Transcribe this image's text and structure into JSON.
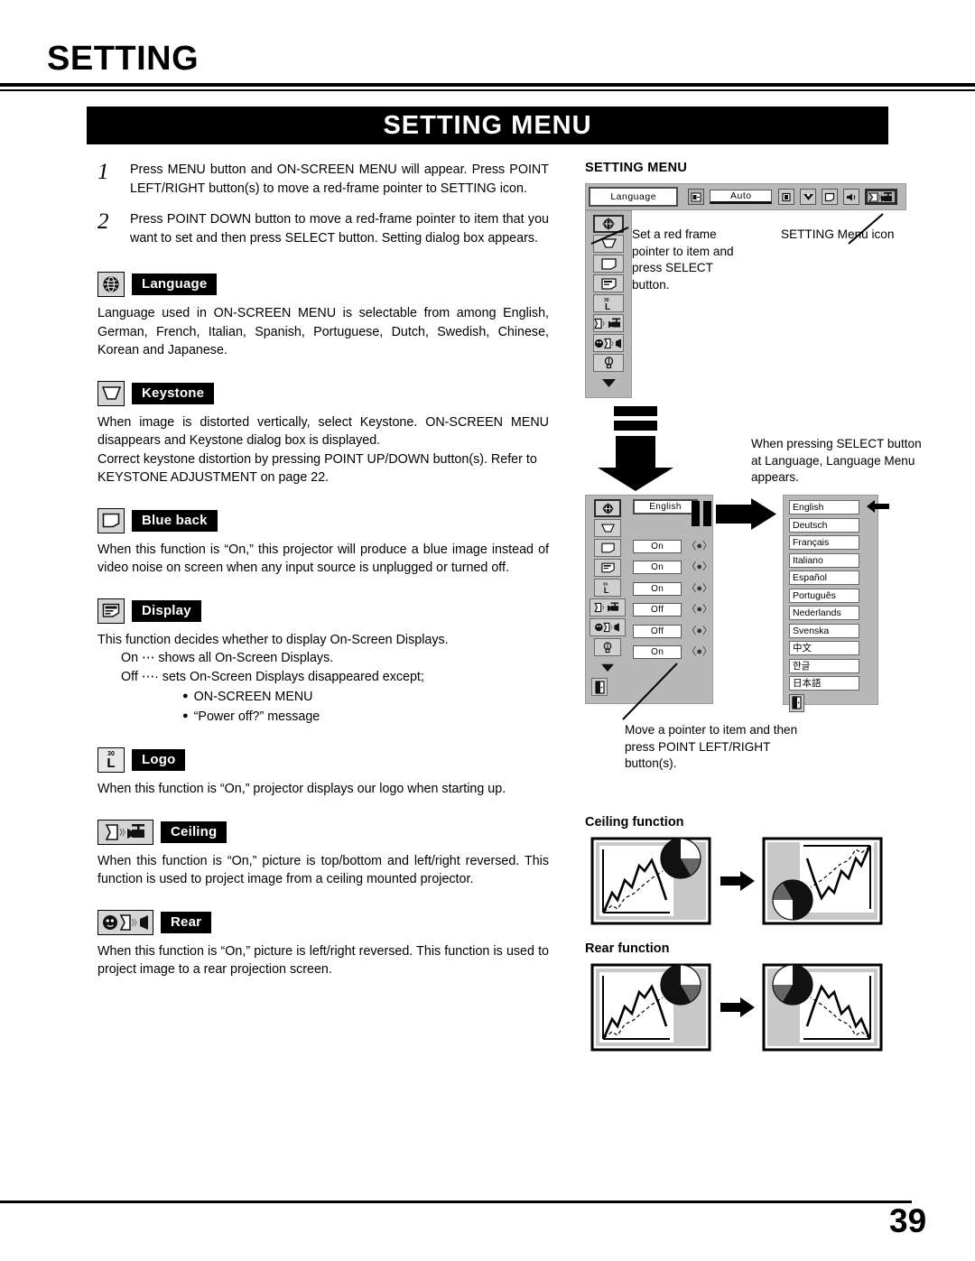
{
  "header": {
    "title": "SETTING",
    "banner": "SETTING MENU"
  },
  "steps": [
    {
      "num": "1",
      "text": "Press MENU button and ON-SCREEN MENU will appear.  Press POINT LEFT/RIGHT button(s) to move a red-frame pointer to SETTING icon."
    },
    {
      "num": "2",
      "text": "Press POINT DOWN button to move a red-frame pointer to item that you want to set and then press SELECT button.  Setting dialog box appears."
    }
  ],
  "functions": [
    {
      "key": "language",
      "label": "Language",
      "icon": "globe-icon",
      "body": "Language used in ON-SCREEN MENU is selectable from among English, German, French, Italian, Spanish, Portuguese, Dutch, Swedish, Chinese, Korean and Japanese."
    },
    {
      "key": "keystone",
      "label": "Keystone",
      "icon": "keystone-trapezoid-icon",
      "body": "When image is distorted vertically, select Keystone.  ON-SCREEN MENU disappears and Keystone dialog box is displayed.",
      "body2": "Correct keystone distortion by pressing POINT UP/DOWN button(s). Refer to KEYSTONE ADJUSTMENT on page 22."
    },
    {
      "key": "blueback",
      "label": "Blue back",
      "icon": "blank-screen-icon",
      "body": "When this function is “On,” this projector will produce a blue image instead of video noise on screen when any input source is unplugged or turned off."
    },
    {
      "key": "display",
      "label": "Display",
      "icon": "display-osd-icon",
      "body": "This function decides whether to display On-Screen Displays.",
      "lines": [
        "On  ⋯ shows all On-Screen Displays.",
        "Off ⋯· sets On-Screen Displays disappeared except;"
      ],
      "bullets": [
        "ON-SCREEN MENU",
        "“Power off?” message"
      ]
    },
    {
      "key": "logo",
      "label": "Logo",
      "icon": "logo-L-icon",
      "icon_text_top": "30",
      "icon_text_main": "L",
      "body": "When this function is “On,” projector displays our logo when starting up."
    },
    {
      "key": "ceiling",
      "label": "Ceiling",
      "icon": "ceiling-mount-icon",
      "body": "When this function is “On,” picture is top/bottom and left/right reversed. This function is used to project image from a ceiling mounted projector."
    },
    {
      "key": "rear",
      "label": "Rear",
      "icon": "rear-projection-icon",
      "body": "When this function is “On,” picture is left/right reversed.  This function is used to project image to a rear projection screen."
    }
  ],
  "osd_top": {
    "title": "SETTING MENU",
    "language_button": "Language",
    "auto_button": "Auto",
    "toolbar_icons": [
      "input-source-icon",
      "image-select-icon",
      "image-adjust-icon",
      "screen-icon",
      "sound-icon",
      "setting-icon"
    ],
    "sidebar_icons": [
      "language-globe-icon",
      "keystone-icon",
      "blue-back-icon",
      "display-icon",
      "logo-icon",
      "ceiling-icon",
      "rear-icon",
      "lamp-icon",
      "down-arrow-icon"
    ]
  },
  "callouts": {
    "pointer_note": "Set a red frame pointer to item and press SELECT button.",
    "menu_icon_note": "SETTING Menu icon",
    "select_note": "When pressing SELECT button at Language, Language Menu appears.",
    "move_note": "Move a pointer to item and then press POINT LEFT/RIGHT button(s)."
  },
  "osd_settings": {
    "sidebar_icons": [
      "language-globe-icon",
      "keystone-icon",
      "blue-back-icon",
      "display-icon",
      "logo-icon",
      "ceiling-icon",
      "rear-icon",
      "lamp-icon",
      "down-arrow-icon",
      "exit-icon"
    ],
    "rows": [
      {
        "name": "language",
        "value": "English",
        "has_lr": false
      },
      {
        "name": "blue-back",
        "value": "On",
        "has_lr": true
      },
      {
        "name": "display",
        "value": "On",
        "has_lr": true
      },
      {
        "name": "logo",
        "value": "On",
        "has_lr": true
      },
      {
        "name": "ceiling",
        "value": "Off",
        "has_lr": true
      },
      {
        "name": "rear",
        "value": "Off",
        "has_lr": true
      },
      {
        "name": "lamp",
        "value": "On",
        "has_lr": true
      }
    ]
  },
  "language_menu": {
    "items": [
      "English",
      "Deutsch",
      "Français",
      "Italiano",
      "Español",
      "Português",
      "Nederlands",
      "Svenska",
      "中文",
      "한글",
      "日本語"
    ],
    "exit_icon": "exit-door-icon",
    "selected": "English"
  },
  "diagrams": {
    "ceiling_title": "Ceiling function",
    "rear_title": "Rear function"
  },
  "footer": {
    "page_number": "39"
  },
  "colors": {
    "osd_panel": "#b8b8b8",
    "osd_icon": "#cfcfcf",
    "banner_bg": "#000000",
    "banner_fg": "#ffffff"
  }
}
